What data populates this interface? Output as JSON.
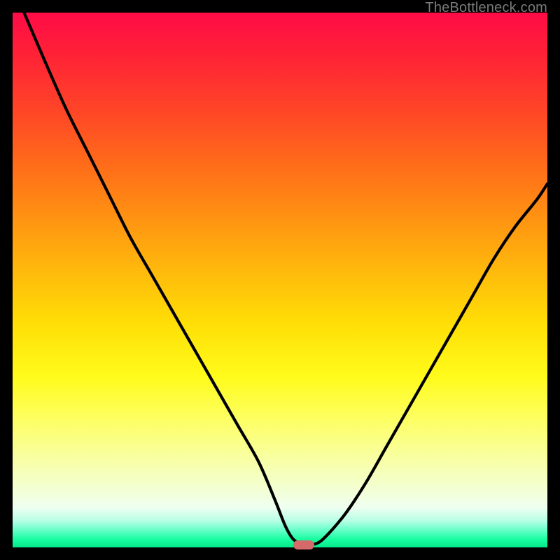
{
  "attribution": "TheBottleneck.com",
  "colors": {
    "frame": "#000000",
    "curve": "#000000",
    "marker": "#d46a6a",
    "gradient_top": "#ff0b47",
    "gradient_bottom": "#04e98a"
  },
  "chart_data": {
    "type": "line",
    "title": "",
    "xlabel": "",
    "ylabel": "",
    "xlim": [
      0,
      100
    ],
    "ylim": [
      0,
      100
    ],
    "series": [
      {
        "name": "bottleneck-curve",
        "x": [
          0,
          3,
          6,
          10,
          14,
          18,
          22,
          26,
          30,
          34,
          38,
          42,
          46,
          49,
          51,
          52.5,
          54,
          55,
          56,
          58,
          62,
          66,
          70,
          74,
          78,
          82,
          86,
          90,
          94,
          98,
          100
        ],
        "values": [
          105,
          98,
          91,
          82,
          74,
          66,
          58,
          51,
          44,
          37,
          30,
          23,
          16,
          9,
          4,
          1.5,
          0.7,
          0.5,
          0.5,
          1.5,
          6,
          12,
          19,
          26,
          33,
          40,
          47,
          54,
          60,
          65,
          68
        ]
      }
    ],
    "annotations": [
      {
        "name": "optimal-marker",
        "x": 54.5,
        "y": 0.5
      }
    ]
  }
}
